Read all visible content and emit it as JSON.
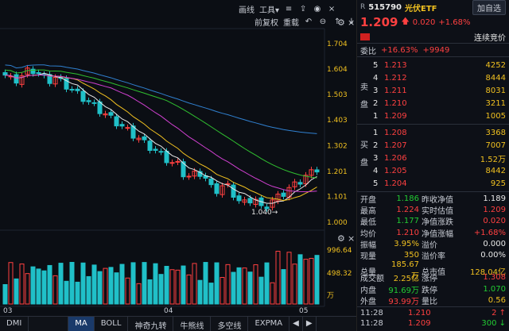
{
  "toolbar": {
    "line_draw": "画线",
    "tools": "工具",
    "adjust": "前复权",
    "overlay": "重载"
  },
  "main_axis": [
    "1.704",
    "1.604",
    "1.503",
    "1.403",
    "1.302",
    "1.201",
    "1.101",
    "1.000"
  ],
  "vol_axis": [
    "996.64",
    "498.32",
    "万"
  ],
  "low_marker": "1.040",
  "x_labels": [
    "03",
    "04",
    "05"
  ],
  "tabs": [
    "DMI",
    "MA",
    "BOLL",
    "神奇九转",
    "牛熊线",
    "多空线",
    "EXPMA"
  ],
  "active_tab": "MA",
  "quote": {
    "exchange": "R",
    "code": "515790",
    "name": "光伏ETF",
    "add_btn": "加自选",
    "price": "1.209",
    "change": "0.020",
    "change_pct": "+1.68%",
    "bid_label": "连续竞价",
    "weibi_label": "委比",
    "weibi_pct": "+16.63%",
    "weibi_val": "+9949"
  },
  "asks": {
    "label1": "卖",
    "label2": "盘",
    "rows": [
      {
        "n": "5",
        "p": "1.213",
        "v": "4252"
      },
      {
        "n": "4",
        "p": "1.212",
        "v": "8444"
      },
      {
        "n": "3",
        "p": "1.211",
        "v": "8031"
      },
      {
        "n": "2",
        "p": "1.210",
        "v": "3211"
      },
      {
        "n": "1",
        "p": "1.209",
        "v": "1005"
      }
    ]
  },
  "bids": {
    "label1": "买",
    "label2": "盘",
    "rows": [
      {
        "n": "1",
        "p": "1.208",
        "v": "3368"
      },
      {
        "n": "2",
        "p": "1.207",
        "v": "7007"
      },
      {
        "n": "3",
        "p": "1.206",
        "v": "1.52万"
      },
      {
        "n": "4",
        "p": "1.205",
        "v": "8442"
      },
      {
        "n": "5",
        "p": "1.204",
        "v": "925"
      }
    ]
  },
  "stats": [
    {
      "l1": "开盘",
      "v1": "1.186",
      "c1": "green",
      "l2": "昨收净值",
      "v2": "1.189",
      "c2": "white"
    },
    {
      "l1": "最高",
      "v1": "1.224",
      "c1": "red",
      "l2": "实时估值",
      "v2": "1.209",
      "c2": "red"
    },
    {
      "l1": "最低",
      "v1": "1.177",
      "c1": "green",
      "l2": "净值涨跌",
      "v2": "0.020",
      "c2": "red"
    },
    {
      "l1": "均价",
      "v1": "1.210",
      "c1": "red",
      "l2": "净值涨幅",
      "v2": "+1.68%",
      "c2": "red"
    },
    {
      "l1": "振幅",
      "v1": "3.95%",
      "c1": "yellow",
      "l2": "溢价",
      "v2": "0.000",
      "c2": "white"
    },
    {
      "l1": "现量",
      "v1": "350",
      "c1": "yellow",
      "l2": "溢价率",
      "v2": "0.00%",
      "c2": "white"
    },
    {
      "l1": "总量",
      "v1": "185.67万",
      "c1": "yellow",
      "l2": "总市值",
      "v2": "128.04亿",
      "c2": "yellow"
    },
    {
      "l1": "成交额",
      "v1": "2.25亿",
      "c1": "yellow",
      "l2": "涨停",
      "v2": "1.308",
      "c2": "red"
    },
    {
      "l1": "内盘",
      "v1": "91.69万",
      "c1": "green",
      "l2": "跌停",
      "v2": "1.070",
      "c2": "green"
    },
    {
      "l1": "外盘",
      "v1": "93.99万",
      "c1": "red",
      "l2": "量比",
      "v2": "0.56",
      "c2": "yellow"
    }
  ],
  "ticks": [
    {
      "t": "11:28",
      "p": "1.210",
      "pc": "red",
      "v": "2",
      "vc": "red",
      "arrow": "↑"
    },
    {
      "t": "11:28",
      "p": "1.209",
      "pc": "red",
      "v": "300",
      "vc": "green",
      "arrow": "↓"
    }
  ],
  "colors": {
    "up": "#ff4040",
    "down": "#22cc33",
    "cyan": "#20c0c8",
    "ma5": "#e8e8e8",
    "ma10": "#f0c020",
    "ma20": "#d040d0",
    "ma30": "#30c030",
    "ma60": "#3080d0"
  }
}
